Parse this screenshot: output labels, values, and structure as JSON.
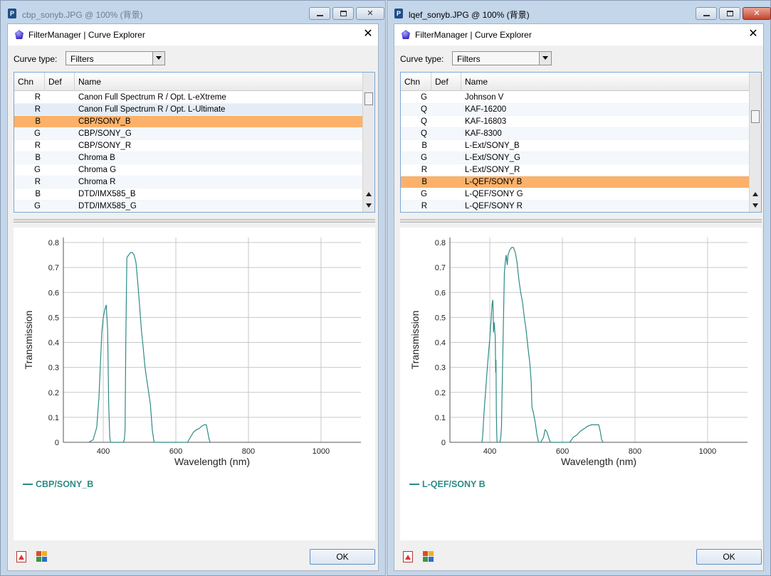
{
  "windows": [
    {
      "id": "left",
      "title": "cbp_sonyb.JPG @ 100% (背景)",
      "dialog_title": "FilterManager | Curve Explorer",
      "curve_type_label": "Curve type:",
      "curve_type_value": "Filters",
      "columns": [
        "Chn",
        "Def",
        "Name"
      ],
      "rows": [
        {
          "chn": "R",
          "def": "",
          "name": "Canon Full Spectrum R / Opt. L-eXtreme",
          "state": "normal"
        },
        {
          "chn": "R",
          "def": "",
          "name": "Canon Full Spectrum R / Opt. L-Ultimate",
          "state": "pale"
        },
        {
          "chn": "B",
          "def": "",
          "name": "CBP/SONY_B",
          "state": "selected"
        },
        {
          "chn": "G",
          "def": "",
          "name": "CBP/SONY_G",
          "state": "normal"
        },
        {
          "chn": "R",
          "def": "",
          "name": "CBP/SONY_R",
          "state": "normal"
        },
        {
          "chn": "B",
          "def": "",
          "name": "Chroma B",
          "state": "normal"
        },
        {
          "chn": "G",
          "def": "",
          "name": "Chroma G",
          "state": "normal"
        },
        {
          "chn": "R",
          "def": "",
          "name": "Chroma R",
          "state": "normal"
        },
        {
          "chn": "B",
          "def": "",
          "name": "DTD/IMX585_B",
          "state": "normal"
        },
        {
          "chn": "G",
          "def": "",
          "name": "DTD/IMX585_G",
          "state": "normal"
        }
      ],
      "scroll_position": 0.2,
      "ok_label": "OK",
      "chart_data": {
        "type": "line",
        "xlabel": "Wavelength (nm)",
        "ylabel": "Transmission",
        "xlim": [
          290,
          1110
        ],
        "ylim": [
          0,
          0.82
        ],
        "xticks": [
          400,
          600,
          800,
          1000
        ],
        "yticks": [
          0,
          0.1,
          0.2,
          0.3,
          0.4,
          0.5,
          0.6,
          0.7,
          0.8
        ],
        "grid": true,
        "legend": "bottom-left",
        "series": [
          {
            "name": "CBP/SONY_B",
            "color": "#2e8b86",
            "x": [
              360,
              372,
              382,
              388,
              392,
              396,
              400,
              404,
              408,
              412,
              415,
              418,
              420,
              455,
              458,
              460,
              462,
              465,
              470,
              475,
              480,
              485,
              490,
              495,
              500,
              505,
              510,
              515,
              520,
              525,
              530,
              535,
              540,
              632,
              640,
              648,
              656,
              664,
              672,
              678,
              684,
              688,
              692,
              695
            ],
            "y": [
              0,
              0.01,
              0.06,
              0.18,
              0.31,
              0.44,
              0.5,
              0.53,
              0.55,
              0.45,
              0.15,
              0.02,
              0,
              0,
              0.01,
              0.05,
              0.4,
              0.74,
              0.75,
              0.76,
              0.76,
              0.75,
              0.72,
              0.64,
              0.55,
              0.45,
              0.38,
              0.3,
              0.25,
              0.2,
              0.15,
              0.05,
              0,
              0,
              0.02,
              0.04,
              0.05,
              0.055,
              0.065,
              0.07,
              0.07,
              0.04,
              0.01,
              0
            ]
          }
        ]
      }
    },
    {
      "id": "right",
      "title": "lqef_sonyb.JPG @ 100% (背景)",
      "dialog_title": "FilterManager | Curve Explorer",
      "curve_type_label": "Curve type:",
      "curve_type_value": "Filters",
      "columns": [
        "Chn",
        "Def",
        "Name"
      ],
      "rows": [
        {
          "chn": "G",
          "def": "",
          "name": "Johnson V",
          "state": "normal"
        },
        {
          "chn": "Q",
          "def": "",
          "name": "KAF-16200",
          "state": "normal"
        },
        {
          "chn": "Q",
          "def": "",
          "name": "KAF-16803",
          "state": "normal"
        },
        {
          "chn": "Q",
          "def": "",
          "name": "KAF-8300",
          "state": "normal"
        },
        {
          "chn": "B",
          "def": "",
          "name": "L-Ext/SONY_B",
          "state": "normal"
        },
        {
          "chn": "G",
          "def": "",
          "name": "L-Ext/SONY_G",
          "state": "normal"
        },
        {
          "chn": "R",
          "def": "",
          "name": "L-Ext/SONY_R",
          "state": "normal"
        },
        {
          "chn": "B",
          "def": "",
          "name": "L-QEF/SONY B",
          "state": "selected"
        },
        {
          "chn": "G",
          "def": "",
          "name": "L-QEF/SONY G",
          "state": "normal"
        },
        {
          "chn": "R",
          "def": "",
          "name": "L-QEF/SONY R",
          "state": "normal"
        }
      ],
      "scroll_position": 0.37,
      "ok_label": "OK",
      "chart_data": {
        "type": "line",
        "xlabel": "Wavelength (nm)",
        "ylabel": "Transmission",
        "xlim": [
          290,
          1110
        ],
        "ylim": [
          0,
          0.82
        ],
        "xticks": [
          400,
          600,
          800,
          1000
        ],
        "yticks": [
          0,
          0.1,
          0.2,
          0.3,
          0.4,
          0.5,
          0.6,
          0.7,
          0.8
        ],
        "grid": true,
        "legend": "bottom-left",
        "series": [
          {
            "name": "L-QEF/SONY B",
            "color": "#2e8b86",
            "x": [
              378,
              380,
              384,
              388,
              392,
              396,
              400,
              404,
              406,
              408,
              409,
              410,
              412,
              415,
              416,
              417,
              418,
              419,
              420,
              428,
              430,
              432,
              435,
              438,
              440,
              443,
              445,
              448,
              450,
              455,
              460,
              465,
              470,
              475,
              480,
              485,
              490,
              495,
              500,
              505,
              510,
              512,
              514,
              516,
              520,
              525,
              530,
              534,
              540,
              548,
              552,
              556,
              560,
              565,
              568,
              620,
              630,
              640,
              650,
              660,
              670,
              680,
              690,
              700,
              705,
              708,
              712
            ],
            "y": [
              0,
              0.02,
              0.12,
              0.2,
              0.28,
              0.35,
              0.42,
              0.5,
              0.55,
              0.57,
              0.53,
              0.44,
              0.48,
              0.42,
              0.28,
              0.33,
              0.12,
              0.03,
              0,
              0,
              0.02,
              0.06,
              0.3,
              0.52,
              0.68,
              0.73,
              0.75,
              0.71,
              0.75,
              0.77,
              0.78,
              0.78,
              0.76,
              0.72,
              0.65,
              0.6,
              0.56,
              0.5,
              0.45,
              0.38,
              0.32,
              0.28,
              0.24,
              0.14,
              0.12,
              0.08,
              0.03,
              0,
              0,
              0.02,
              0.05,
              0.045,
              0.03,
              0.005,
              0,
              0,
              0.02,
              0.03,
              0.045,
              0.055,
              0.065,
              0.07,
              0.07,
              0.07,
              0.04,
              0.01,
              0
            ]
          }
        ]
      }
    }
  ]
}
